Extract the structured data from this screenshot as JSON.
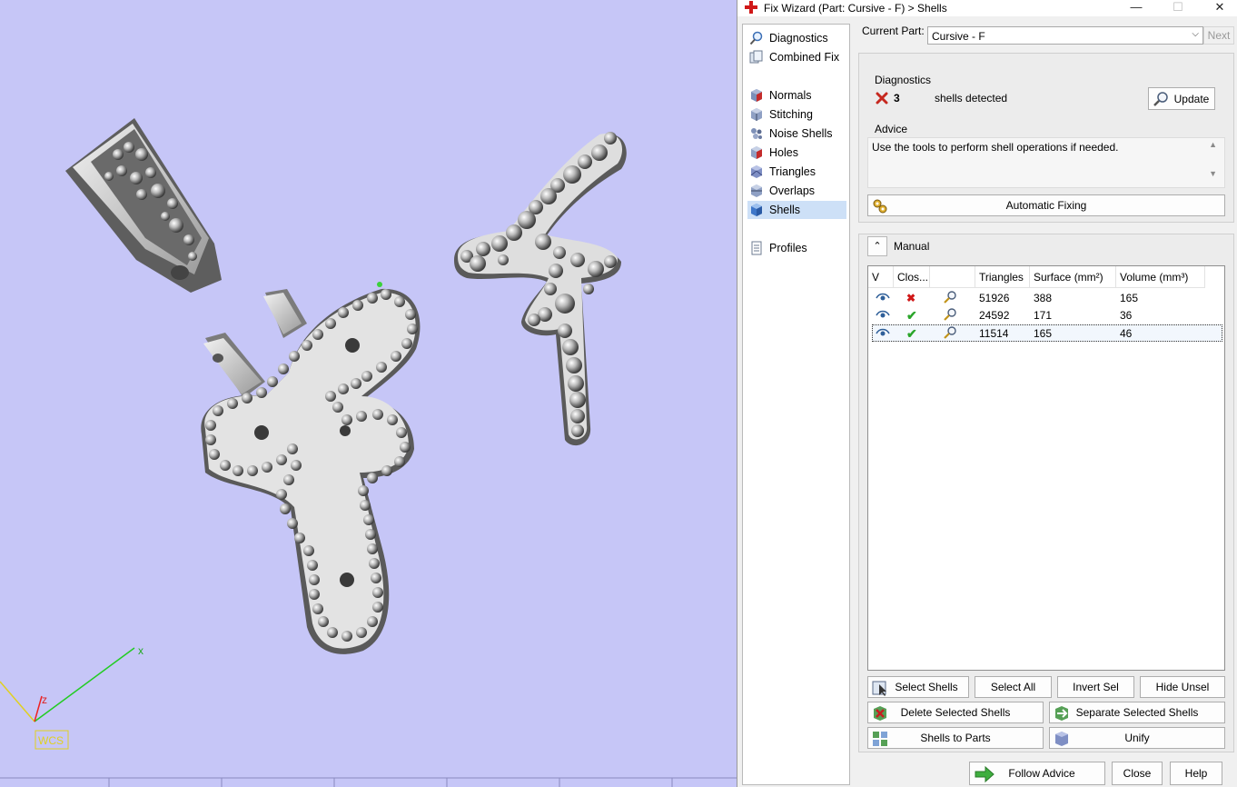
{
  "window": {
    "title": "Fix Wizard (Part: Cursive - F) > Shells",
    "minimize": "—",
    "maximize": "☐",
    "close": "✕"
  },
  "nav": {
    "items": [
      {
        "label": "Diagnostics",
        "icon": "magnifier-icon"
      },
      {
        "label": "Combined Fix",
        "icon": "combined-fix-icon"
      },
      {
        "label": "Normals",
        "icon": "normals-cube-icon"
      },
      {
        "label": "Stitching",
        "icon": "stitching-cube-icon"
      },
      {
        "label": "Noise Shells",
        "icon": "noise-shells-icon"
      },
      {
        "label": "Holes",
        "icon": "holes-cube-icon"
      },
      {
        "label": "Triangles",
        "icon": "triangles-cube-icon"
      },
      {
        "label": "Overlaps",
        "icon": "overlaps-cube-icon"
      },
      {
        "label": "Shells",
        "icon": "shells-cube-icon",
        "selected": true
      },
      {
        "label": "Profiles",
        "icon": "profiles-doc-icon"
      }
    ]
  },
  "current_part": {
    "label": "Current Part:",
    "value": "Cursive - F",
    "next_label": "Next"
  },
  "diagnostics": {
    "heading": "Diagnostics",
    "count": "3",
    "text": "shells detected",
    "status": "error",
    "update_label": "Update"
  },
  "advice": {
    "heading": "Advice",
    "text": "Use the tools to perform shell operations if needed."
  },
  "auto_fix_label": "Automatic Fixing",
  "manual": {
    "heading": "Manual",
    "columns": [
      "V",
      "Clos...",
      "",
      "Triangles",
      "Surface (mm²)",
      "Volume (mm³)"
    ],
    "rows": [
      {
        "closed": false,
        "triangles": "51926",
        "surface": "388",
        "volume": "165"
      },
      {
        "closed": true,
        "triangles": "24592",
        "surface": "171",
        "volume": "36"
      },
      {
        "closed": true,
        "triangles": "11514",
        "surface": "165",
        "volume": "46",
        "selected": true
      }
    ],
    "buttons": {
      "select_shells": "Select Shells",
      "select_all": "Select All",
      "invert_sel": "Invert Sel",
      "hide_unsel": "Hide Unsel",
      "delete_selected": "Delete Selected Shells",
      "separate_selected": "Separate Selected Shells",
      "shells_to_parts": "Shells to Parts",
      "unify": "Unify"
    }
  },
  "footer": {
    "follow_advice": "Follow Advice",
    "close": "Close",
    "help": "Help"
  },
  "viewport": {
    "axes": {
      "x": "x",
      "z": "z",
      "wcs": "WCS"
    },
    "background": "#c6c6f7"
  }
}
